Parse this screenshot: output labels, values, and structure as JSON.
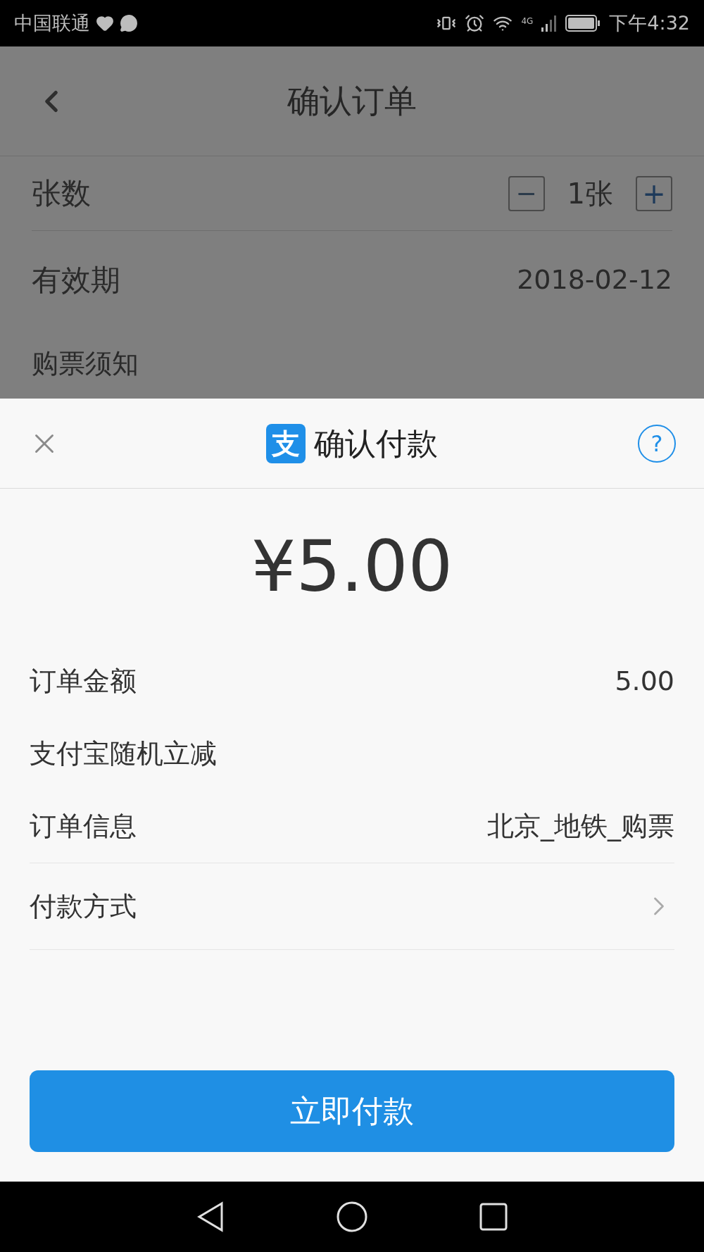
{
  "status_bar": {
    "carrier": "中国联通",
    "time": "下午4:32",
    "network": "4G"
  },
  "header": {
    "title": "确认订单"
  },
  "order": {
    "quantity": {
      "label": "张数",
      "value": "1张",
      "minus": "−",
      "plus": "+"
    },
    "validity": {
      "label": "有效期",
      "value": "2018-02-12"
    },
    "notice_title": "购票须知"
  },
  "payment_sheet": {
    "logo_text": "支",
    "title": "确认付款",
    "help": "?",
    "amount": "¥5.00",
    "rows": [
      {
        "label": "订单金额",
        "value": "5.00",
        "kind": "plain"
      },
      {
        "label": "支付宝随机立减",
        "kind": "plain"
      },
      {
        "label": "订单信息",
        "value": "北京_地铁_购票",
        "kind": "plain"
      },
      {
        "label": "付款方式",
        "kind": "link"
      }
    ],
    "pay_button": "立即付款"
  }
}
